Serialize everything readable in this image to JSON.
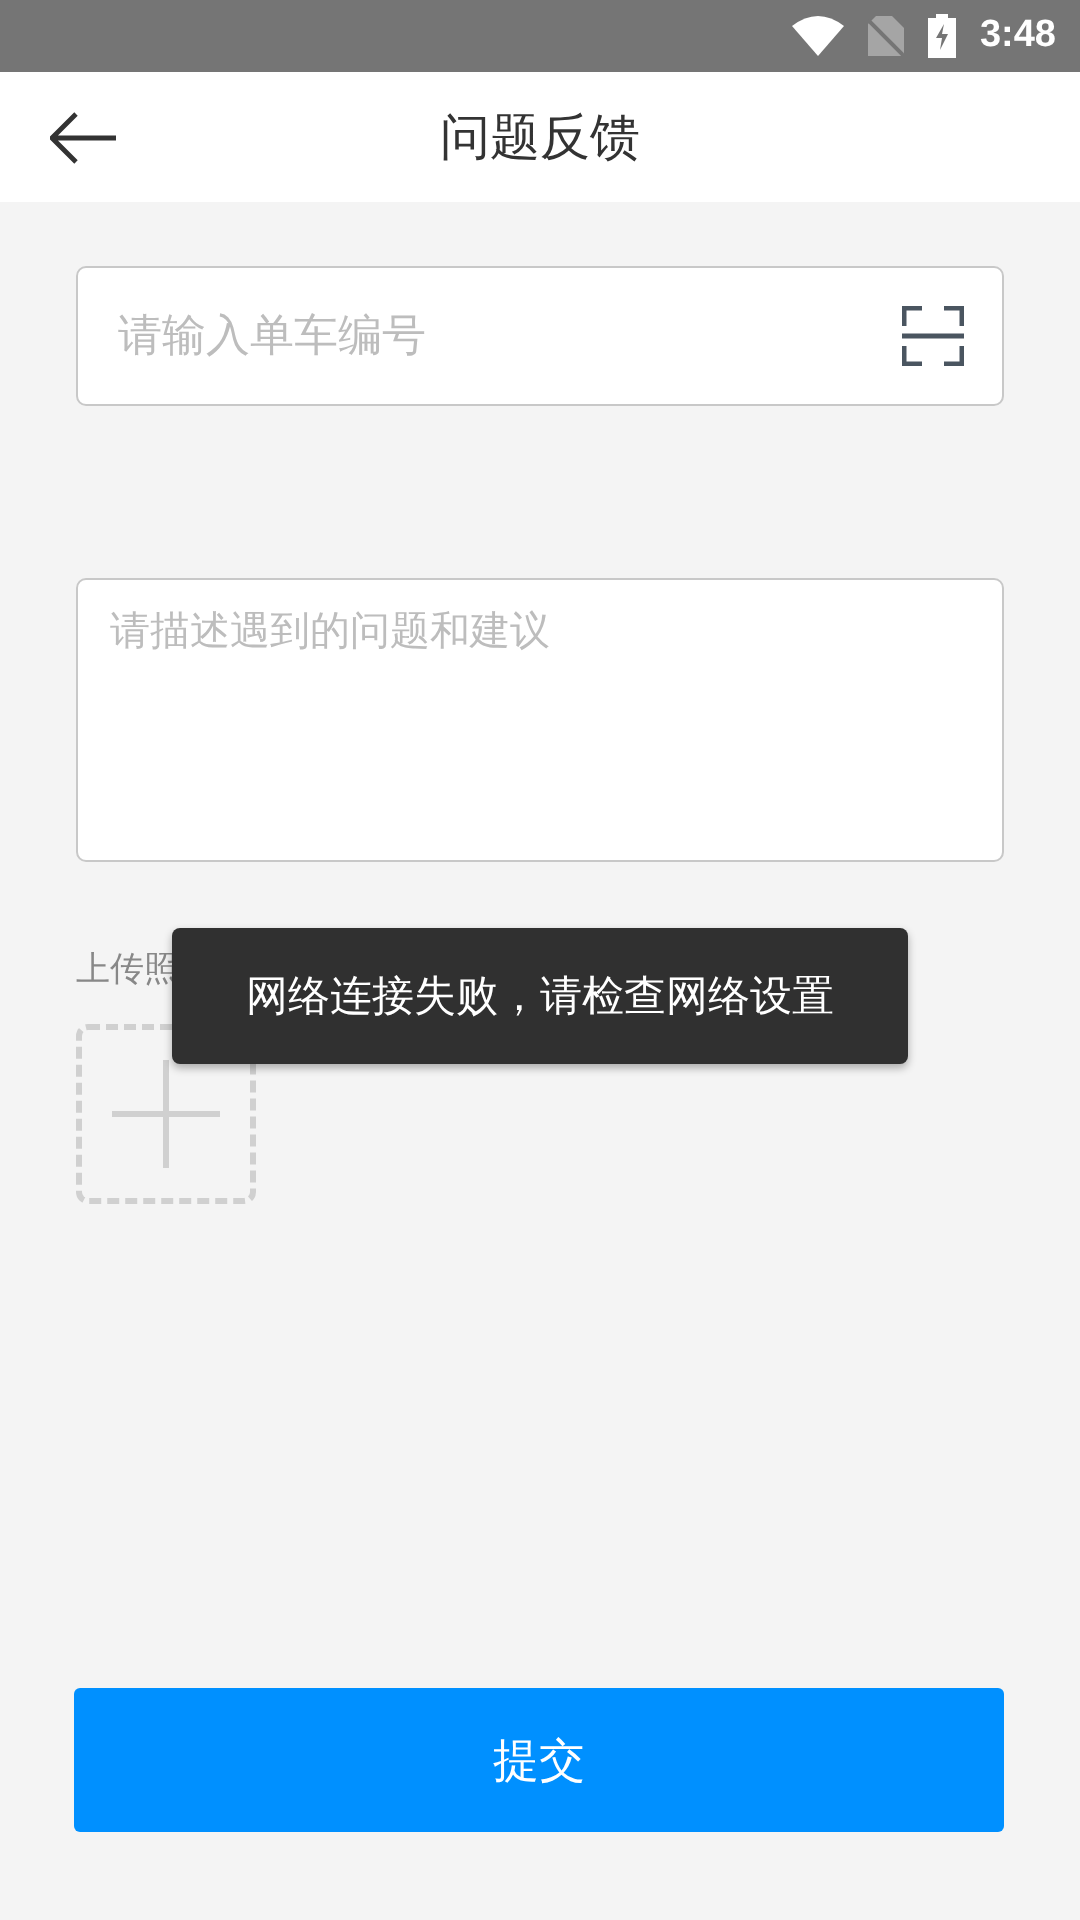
{
  "status_bar": {
    "time": "3:48"
  },
  "header": {
    "title": "问题反馈"
  },
  "bike_number": {
    "placeholder": "请输入单车编号"
  },
  "description": {
    "placeholder": "请描述遇到的问题和建议"
  },
  "upload": {
    "label": "上传照"
  },
  "toast": {
    "message": "网络连接失败，请检查网络设置"
  },
  "submit": {
    "label": "提交"
  }
}
